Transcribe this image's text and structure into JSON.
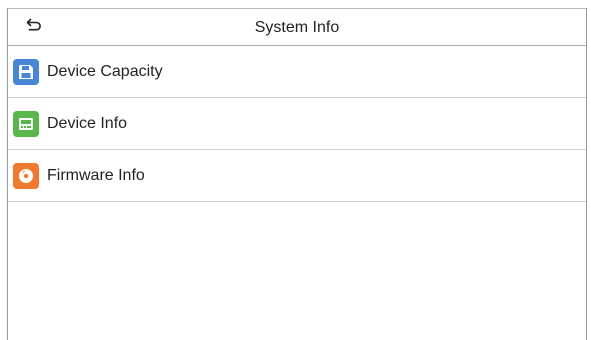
{
  "header": {
    "title": "System Info",
    "back_icon": "back-arrow-icon"
  },
  "menu": {
    "items": [
      {
        "label": "Device Capacity",
        "icon": "floppy-disk-icon",
        "icon_color": "#4a86d8"
      },
      {
        "label": "Device Info",
        "icon": "device-terminal-icon",
        "icon_color": "#5ab54a"
      },
      {
        "label": "Firmware Info",
        "icon": "disc-icon",
        "icon_color": "#f07a2d"
      }
    ]
  }
}
